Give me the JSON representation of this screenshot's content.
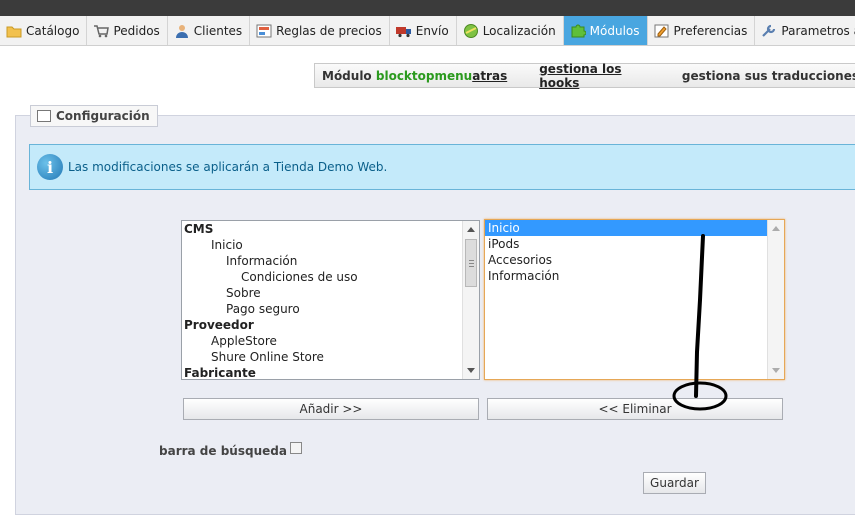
{
  "nav": {
    "tabs": [
      {
        "label": "Catálogo",
        "icon": "folder-icon"
      },
      {
        "label": "Pedidos",
        "icon": "cart-icon"
      },
      {
        "label": "Clientes",
        "icon": "user-icon"
      },
      {
        "label": "Reglas de precios",
        "icon": "price-rules-icon"
      },
      {
        "label": "Envío",
        "icon": "truck-icon"
      },
      {
        "label": "Localización",
        "icon": "globe-icon"
      },
      {
        "label": "Módulos",
        "icon": "puzzle-icon"
      },
      {
        "label": "Preferencias",
        "icon": "preferences-icon"
      },
      {
        "label": "Parametros avanz",
        "icon": "wrench-icon"
      }
    ],
    "active_tab": "Módulos",
    "active_color": "#49a6e0"
  },
  "toolbar": {
    "module_prefix": "Módulo",
    "module_name": "blocktopmenu",
    "module_name_color": "#2b9a1e",
    "back_link": "atras",
    "hooks_link": "gestiona los hooks",
    "translations_link": "gestiona sus traducciones"
  },
  "config": {
    "legend": "Configuración",
    "info_message": "Las modificaciones se aplicarán a Tienda Demo Web."
  },
  "available_list": {
    "options": [
      {
        "label": "CMS",
        "level": 0,
        "group": true
      },
      {
        "label": "Inicio",
        "level": 1
      },
      {
        "label": "Información",
        "level": 2
      },
      {
        "label": "Condiciones de uso",
        "level": 3
      },
      {
        "label": "Sobre",
        "level": 2
      },
      {
        "label": "Pago seguro",
        "level": 2
      },
      {
        "label": "Proveedor",
        "level": 0,
        "group": true
      },
      {
        "label": "AppleStore",
        "level": 1
      },
      {
        "label": "Shure Online Store",
        "level": 1
      },
      {
        "label": "Fabricante",
        "level": 0,
        "group": true
      }
    ]
  },
  "selected_list": {
    "options": [
      {
        "label": "Inicio",
        "selected": true
      },
      {
        "label": "iPods"
      },
      {
        "label": "Accesorios"
      },
      {
        "label": "Información"
      }
    ]
  },
  "buttons": {
    "add": "Añadir >>",
    "remove": "<< Eliminar",
    "save": "Guardar"
  },
  "search_bar": {
    "label": "barra de búsqueda",
    "checked": false
  }
}
